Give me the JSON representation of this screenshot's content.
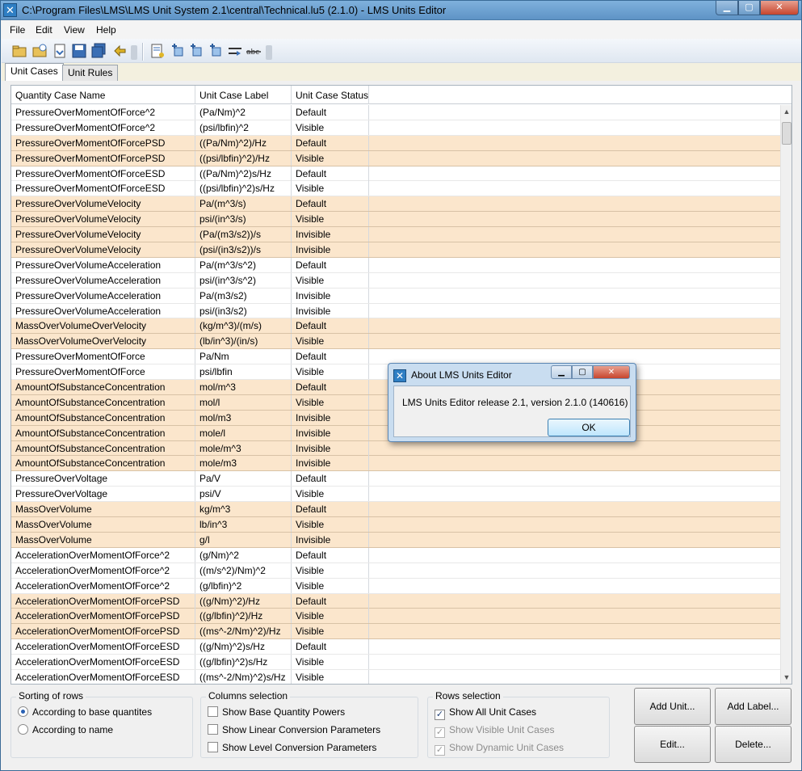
{
  "window": {
    "title": "C:\\Program Files\\LMS\\LMS Unit System 2.1\\central\\Technical.lu5 (2.1.0) - LMS Units Editor",
    "min_symbol": "▁",
    "max_symbol": "▢",
    "close_symbol": "✕"
  },
  "menu": [
    "File",
    "Edit",
    "View",
    "Help"
  ],
  "toolbar": {
    "icons": [
      "open-folder-icon",
      "open-recent-icon",
      "import-icon",
      "save-icon",
      "save-all-icon",
      "undo-icon",
      "document-properties-icon",
      "add-unit-icon",
      "add-label-icon",
      "add-case-icon",
      "merge-icon",
      "strikethrough-icon"
    ],
    "accent": "#3a6fb5"
  },
  "tabs": [
    {
      "label": "Unit Cases",
      "active": true
    },
    {
      "label": "Unit Rules",
      "active": false
    }
  ],
  "grid": {
    "columns": [
      "Quantity Case Name",
      "Unit Case Label",
      "Unit Case Status"
    ],
    "highlight_color": "#fbe6cc",
    "scroll_up": "▲",
    "scroll_down": "▼",
    "rows": [
      {
        "name": "PressureOverMomentOfForce^2",
        "label": "(Pa/Nm)^2",
        "status": "Default",
        "hl": false
      },
      {
        "name": "PressureOverMomentOfForce^2",
        "label": "(psi/lbfin)^2",
        "status": "Visible",
        "hl": false
      },
      {
        "name": "PressureOverMomentOfForcePSD",
        "label": "((Pa/Nm)^2)/Hz",
        "status": "Default",
        "hl": true
      },
      {
        "name": "PressureOverMomentOfForcePSD",
        "label": "((psi/lbfin)^2)/Hz",
        "status": "Visible",
        "hl": true
      },
      {
        "name": "PressureOverMomentOfForceESD",
        "label": "((Pa/Nm)^2)s/Hz",
        "status": "Default",
        "hl": false
      },
      {
        "name": "PressureOverMomentOfForceESD",
        "label": "((psi/lbfin)^2)s/Hz",
        "status": "Visible",
        "hl": false
      },
      {
        "name": "PressureOverVolumeVelocity",
        "label": "Pa/(m^3/s)",
        "status": "Default",
        "hl": true
      },
      {
        "name": "PressureOverVolumeVelocity",
        "label": "psi/(in^3/s)",
        "status": "Visible",
        "hl": true
      },
      {
        "name": "PressureOverVolumeVelocity",
        "label": "(Pa/(m3/s2))/s",
        "status": "Invisible",
        "hl": true
      },
      {
        "name": "PressureOverVolumeVelocity",
        "label": "(psi/(in3/s2))/s",
        "status": "Invisible",
        "hl": true
      },
      {
        "name": "PressureOverVolumeAcceleration",
        "label": "Pa/(m^3/s^2)",
        "status": "Default",
        "hl": false
      },
      {
        "name": "PressureOverVolumeAcceleration",
        "label": "psi/(in^3/s^2)",
        "status": "Visible",
        "hl": false
      },
      {
        "name": "PressureOverVolumeAcceleration",
        "label": "Pa/(m3/s2)",
        "status": "Invisible",
        "hl": false
      },
      {
        "name": "PressureOverVolumeAcceleration",
        "label": "psi/(in3/s2)",
        "status": "Invisible",
        "hl": false
      },
      {
        "name": "MassOverVolumeOverVelocity",
        "label": "(kg/m^3)/(m/s)",
        "status": "Default",
        "hl": true
      },
      {
        "name": "MassOverVolumeOverVelocity",
        "label": "(lb/in^3)/(in/s)",
        "status": "Visible",
        "hl": true
      },
      {
        "name": "PressureOverMomentOfForce",
        "label": "Pa/Nm",
        "status": "Default",
        "hl": false
      },
      {
        "name": "PressureOverMomentOfForce",
        "label": "psi/lbfin",
        "status": "Visible",
        "hl": false
      },
      {
        "name": "AmountOfSubstanceConcentration",
        "label": "mol/m^3",
        "status": "Default",
        "hl": true
      },
      {
        "name": "AmountOfSubstanceConcentration",
        "label": "mol/l",
        "status": "Visible",
        "hl": true
      },
      {
        "name": "AmountOfSubstanceConcentration",
        "label": "mol/m3",
        "status": "Invisible",
        "hl": true
      },
      {
        "name": "AmountOfSubstanceConcentration",
        "label": "mole/l",
        "status": "Invisible",
        "hl": true
      },
      {
        "name": "AmountOfSubstanceConcentration",
        "label": "mole/m^3",
        "status": "Invisible",
        "hl": true
      },
      {
        "name": "AmountOfSubstanceConcentration",
        "label": "mole/m3",
        "status": "Invisible",
        "hl": true
      },
      {
        "name": "PressureOverVoltage",
        "label": "Pa/V",
        "status": "Default",
        "hl": false
      },
      {
        "name": "PressureOverVoltage",
        "label": "psi/V",
        "status": "Visible",
        "hl": false
      },
      {
        "name": "MassOverVolume",
        "label": "kg/m^3",
        "status": "Default",
        "hl": true
      },
      {
        "name": "MassOverVolume",
        "label": "lb/in^3",
        "status": "Visible",
        "hl": true
      },
      {
        "name": "MassOverVolume",
        "label": "g/l",
        "status": "Invisible",
        "hl": true
      },
      {
        "name": "AccelerationOverMomentOfForce^2",
        "label": "(g/Nm)^2",
        "status": "Default",
        "hl": false
      },
      {
        "name": "AccelerationOverMomentOfForce^2",
        "label": "((m/s^2)/Nm)^2",
        "status": "Visible",
        "hl": false
      },
      {
        "name": "AccelerationOverMomentOfForce^2",
        "label": "(g/lbfin)^2",
        "status": "Visible",
        "hl": false
      },
      {
        "name": "AccelerationOverMomentOfForcePSD",
        "label": "((g/Nm)^2)/Hz",
        "status": "Default",
        "hl": true
      },
      {
        "name": "AccelerationOverMomentOfForcePSD",
        "label": "((g/lbfin)^2)/Hz",
        "status": "Visible",
        "hl": true
      },
      {
        "name": "AccelerationOverMomentOfForcePSD",
        "label": "((ms^-2/Nm)^2)/Hz",
        "status": "Visible",
        "hl": true
      },
      {
        "name": "AccelerationOverMomentOfForceESD",
        "label": "((g/Nm)^2)s/Hz",
        "status": "Default",
        "hl": false
      },
      {
        "name": "AccelerationOverMomentOfForceESD",
        "label": "((g/lbfin)^2)s/Hz",
        "status": "Visible",
        "hl": false
      },
      {
        "name": "AccelerationOverMomentOfForceESD",
        "label": "((ms^-2/Nm)^2)s/Hz",
        "status": "Visible",
        "hl": false
      }
    ]
  },
  "sorting": {
    "title": "Sorting of rows",
    "options": [
      {
        "label": "According to base quantites",
        "selected": true
      },
      {
        "label": "According to name",
        "selected": false
      }
    ]
  },
  "columns_selection": {
    "title": "Columns selection",
    "options": [
      {
        "label": "Show Base Quantity Powers",
        "checked": false,
        "enabled": true
      },
      {
        "label": "Show Linear Conversion Parameters",
        "checked": false,
        "enabled": true
      },
      {
        "label": "Show Level Conversion Parameters",
        "checked": false,
        "enabled": true
      }
    ]
  },
  "rows_selection": {
    "title": "Rows selection",
    "options": [
      {
        "label": "Show All Unit Cases",
        "checked": true,
        "enabled": true
      },
      {
        "label": "Show Visible Unit Cases",
        "checked": true,
        "enabled": false
      },
      {
        "label": "Show Dynamic Unit Cases",
        "checked": true,
        "enabled": false
      }
    ]
  },
  "buttons": {
    "add_unit": "Add Unit...",
    "add_label": "Add Label...",
    "edit": "Edit...",
    "delete": "Delete..."
  },
  "dialog": {
    "title": "About LMS Units Editor",
    "message": "LMS Units Editor release 2.1, version 2.1.0 (140616)",
    "ok": "OK"
  }
}
